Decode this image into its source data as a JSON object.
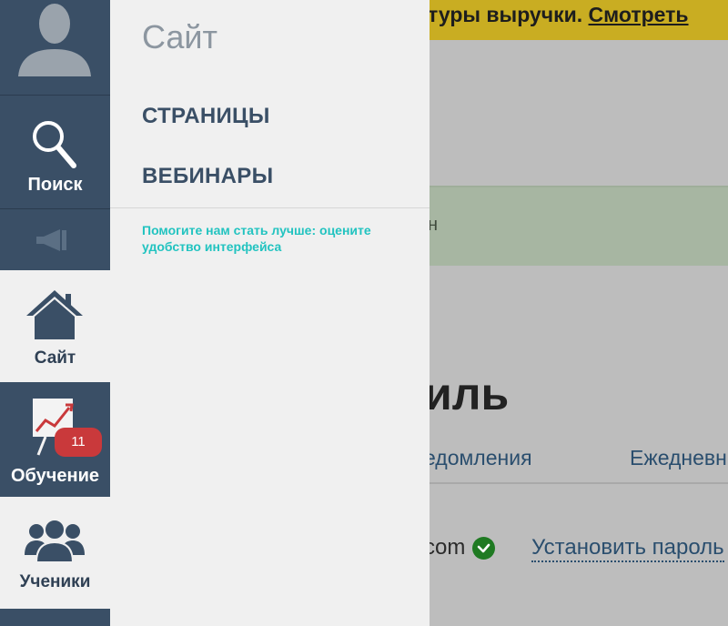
{
  "background": {
    "banner_text": "туры выручки. ",
    "banner_link": "Смотреть",
    "notice_text": "н",
    "heading": "иль",
    "tabs": [
      "едомления",
      "Ежедневн"
    ],
    "email": "com",
    "set_password_link": "Установить пароль"
  },
  "rail": {
    "search_label": "Поиск",
    "site_label": "Сайт",
    "learning_label": "Обучение",
    "learning_badge": "11",
    "students_label": "Ученики"
  },
  "panel": {
    "title": "Сайт",
    "links": [
      "СТРАНИЦЫ",
      "ВЕБИНАРЫ"
    ],
    "feedback": "Помогите нам стать лучше: оцените удобство интерфейса"
  },
  "colors": {
    "rail": "#3a4f66",
    "panel": "#f0f0f0",
    "accent": "#22c3c0",
    "badge": "#c9393b",
    "banner": "#c9ad22"
  }
}
